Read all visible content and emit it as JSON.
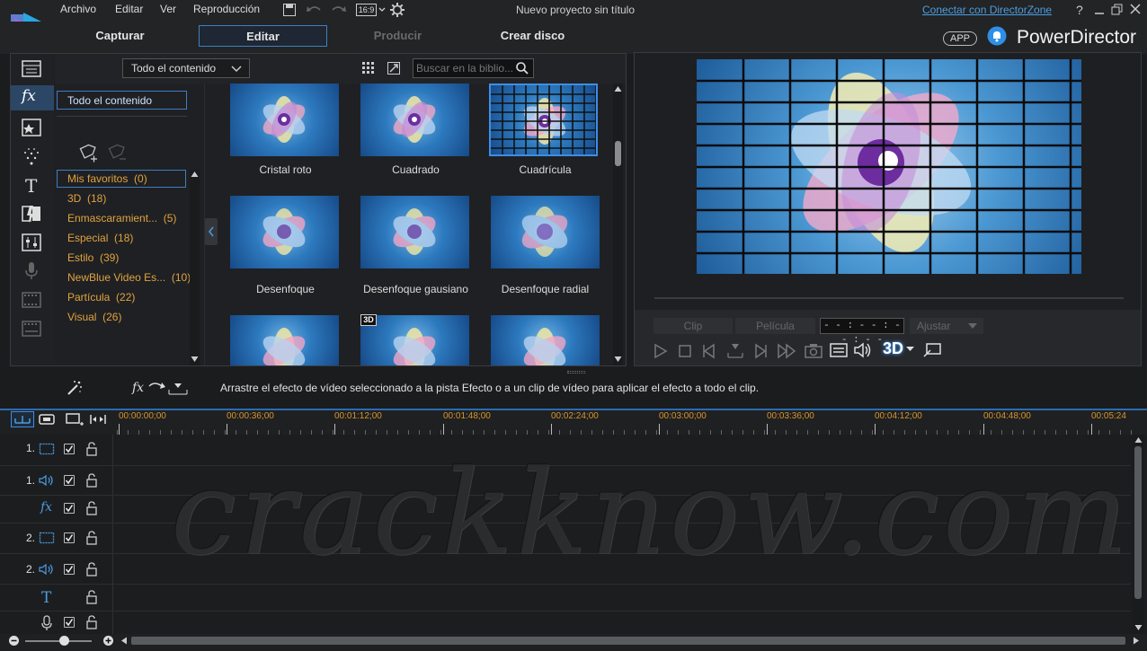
{
  "menu": {
    "items": [
      "Archivo",
      "Editar",
      "Ver",
      "Reproducción"
    ],
    "aspect_ratio": "16:9",
    "window_title": "Nuevo proyecto sin título",
    "directorzone_link": "Conectar con DirectorZone",
    "help": "?"
  },
  "modes": {
    "capture": "Capturar",
    "edit": "Editar",
    "produce": "Producir",
    "disc": "Crear disco"
  },
  "brand": {
    "app_badge": "APP",
    "name": "PowerDirector"
  },
  "library": {
    "filter_dropdown": "Todo el contenido",
    "search_placeholder": "Buscar en la biblio...",
    "tree_selected": "Todo el contenido",
    "categories": [
      {
        "label": "Mis favoritos",
        "count": "(0)"
      },
      {
        "label": "3D",
        "count": "(18)"
      },
      {
        "label": "Enmascaramient...",
        "count": "(5)"
      },
      {
        "label": "Especial",
        "count": "(18)"
      },
      {
        "label": "Estilo",
        "count": "(39)"
      },
      {
        "label": "NewBlue Video Es...",
        "count": "(10)"
      },
      {
        "label": "Partícula",
        "count": "(22)"
      },
      {
        "label": "Visual",
        "count": "(26)"
      }
    ],
    "effects": [
      {
        "label": "Cristal roto"
      },
      {
        "label": "Cuadrado"
      },
      {
        "label": "Cuadrícula"
      },
      {
        "label": "Desenfoque"
      },
      {
        "label": "Desenfoque gausiano"
      },
      {
        "label": "Desenfoque radial"
      }
    ],
    "badge_3d": "3D"
  },
  "preview": {
    "clip_btn": "Clip",
    "movie_btn": "Película",
    "timecode": "- - : - - : - - : - -",
    "adjust": "Ajustar",
    "three_d": "3D"
  },
  "instruction": "Arrastre el efecto de vídeo seleccionado a la pista Efecto o a un clip de vídeo para aplicar el efecto a todo el clip.",
  "timeline": {
    "ticks": [
      "00:00:00;00",
      "00:00:36;00",
      "00:01:12;00",
      "00:01:48;00",
      "00:02:24;00",
      "00:03:00;00",
      "00:03:36;00",
      "00:04:12;00",
      "00:04:48;00",
      "00:05:24"
    ],
    "tracks": [
      {
        "num": "1.",
        "type": "video"
      },
      {
        "num": "1.",
        "type": "audio"
      },
      {
        "num": "",
        "type": "fx"
      },
      {
        "num": "2.",
        "type": "video"
      },
      {
        "num": "2.",
        "type": "audio"
      },
      {
        "num": "",
        "type": "title"
      },
      {
        "num": "",
        "type": "voice"
      }
    ]
  },
  "watermark": "crackknow.com",
  "colors": {
    "accent": "#3d8ee8",
    "category_text": "#e0a340",
    "ruler_text": "#d9962a",
    "link": "#4a9de0"
  }
}
